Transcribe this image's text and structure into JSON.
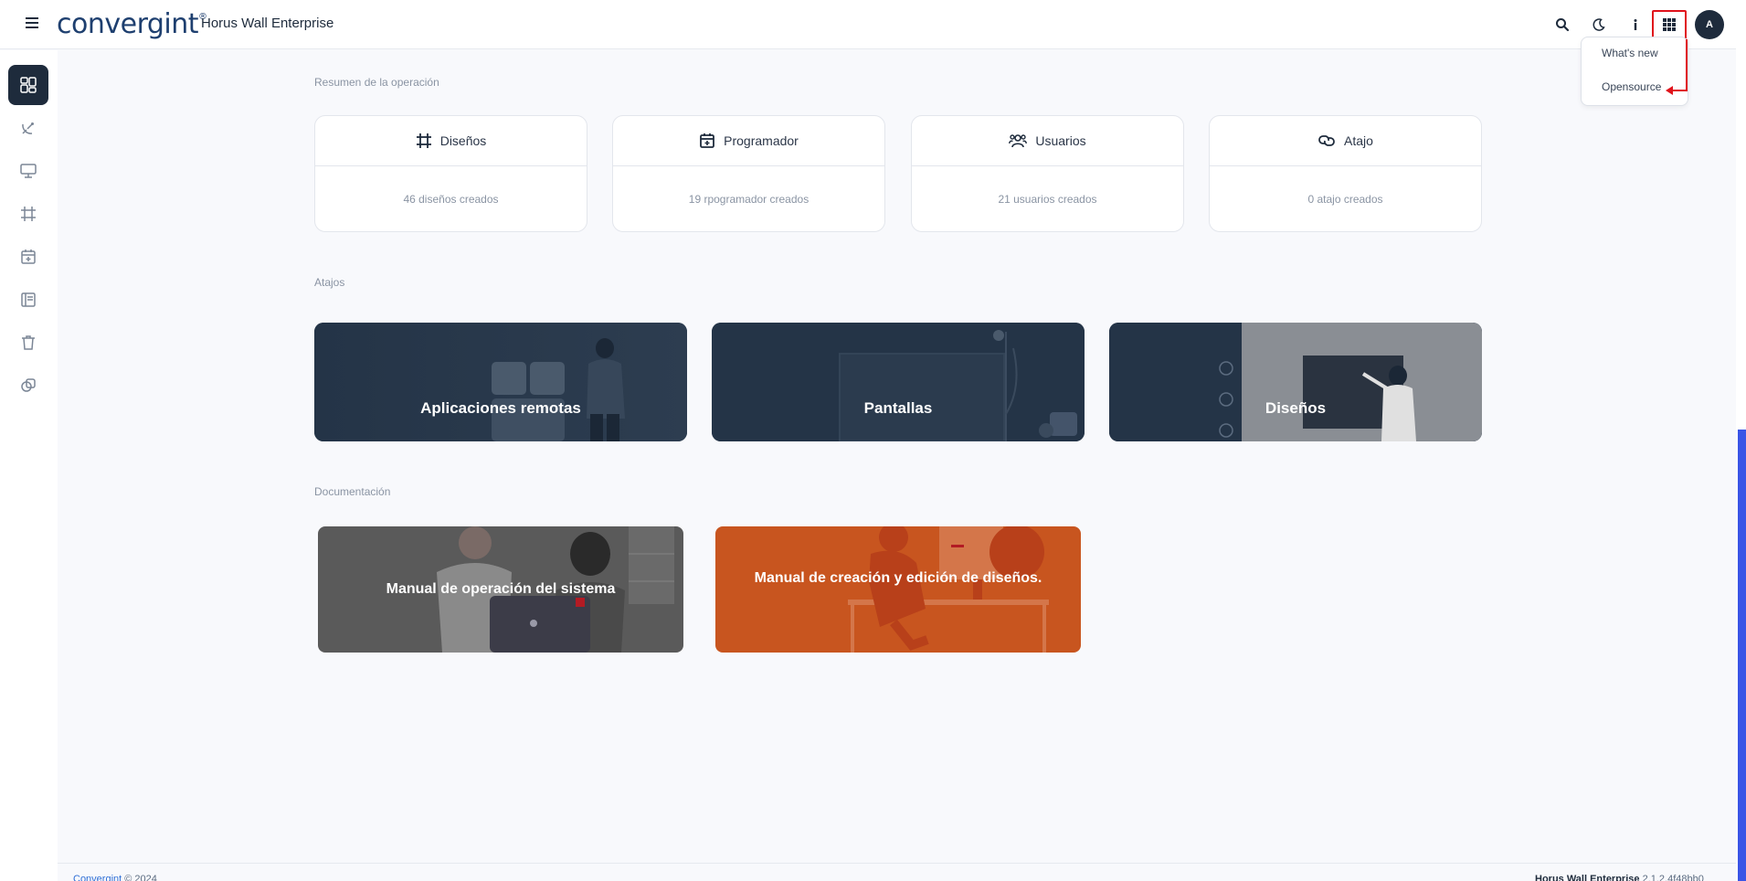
{
  "header": {
    "logo": "convergint",
    "logo_tm": "®",
    "app_title": "Horus Wall Enterprise",
    "avatar_initial": "A"
  },
  "apps_menu": {
    "items": [
      "What's new",
      "Opensource"
    ]
  },
  "sidebar": {
    "items": [
      "dashboard-icon",
      "satellite-dish-icon",
      "monitor-icon",
      "crop-icon",
      "calendar-icon",
      "layout-icon",
      "trash-icon",
      "copy-icon"
    ]
  },
  "summary": {
    "label": "Resumen de la operación",
    "cards": [
      {
        "title": "Diseños",
        "value": "46 diseños creados"
      },
      {
        "title": "Programador",
        "value": "19 rpogramador creados"
      },
      {
        "title": "Usuarios",
        "value": "21 usuarios creados"
      },
      {
        "title": "Atajo",
        "value": "0 atajo creados"
      }
    ]
  },
  "shortcuts": {
    "label": "Atajos",
    "items": [
      "Aplicaciones remotas",
      "Pantallas",
      "Diseños"
    ]
  },
  "documentation": {
    "label": "Documentación",
    "items": [
      "Manual de operación del sistema",
      "Manual de creación y edición de diseños."
    ]
  },
  "footer": {
    "company": "Convergint",
    "copyright": "© 2024",
    "product": "Horus Wall Enterprise",
    "version": "2.1.2.4f48bb0"
  },
  "colors": {
    "primary": "#1e2b3c",
    "annotation": "#e0121b",
    "doc_gray": "#5a5a5a",
    "doc_orange": "#c8551f"
  }
}
